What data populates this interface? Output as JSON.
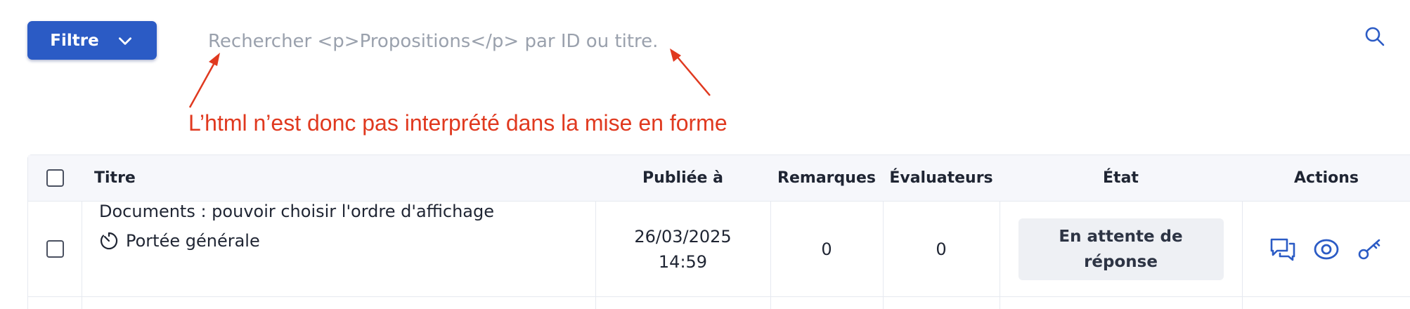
{
  "toolbar": {
    "filter_label": "Filtre",
    "search_placeholder": "Rechercher <p>Propositions</p> par ID ou titre."
  },
  "annotation": {
    "text": "L’html n’est donc pas interprété dans la mise en forme",
    "color": "#e0391f"
  },
  "table": {
    "columns": {
      "title": "Titre",
      "published": "Publiée à",
      "remarks": "Remarques",
      "evaluators": "Évaluateurs",
      "state": "État",
      "actions": "Actions"
    },
    "rows": [
      {
        "title": "Documents : pouvoir choisir l'ordre d'affichage",
        "scope": "Portée générale",
        "date": "26/03/2025",
        "time": "14:59",
        "remarks": "0",
        "evaluators": "0",
        "state_line1": "En attente de",
        "state_line2": "réponse"
      }
    ]
  },
  "icons": {
    "filter": "chevron-down-icon",
    "search": "search-icon",
    "scope": "timer-icon",
    "actions": [
      "comments-icon",
      "eye-icon",
      "key-icon"
    ]
  },
  "colors": {
    "primary": "#2b5bc5",
    "header_bg": "#f6f7fb",
    "badge_bg": "#eef0f4",
    "annotation": "#e0391f"
  }
}
